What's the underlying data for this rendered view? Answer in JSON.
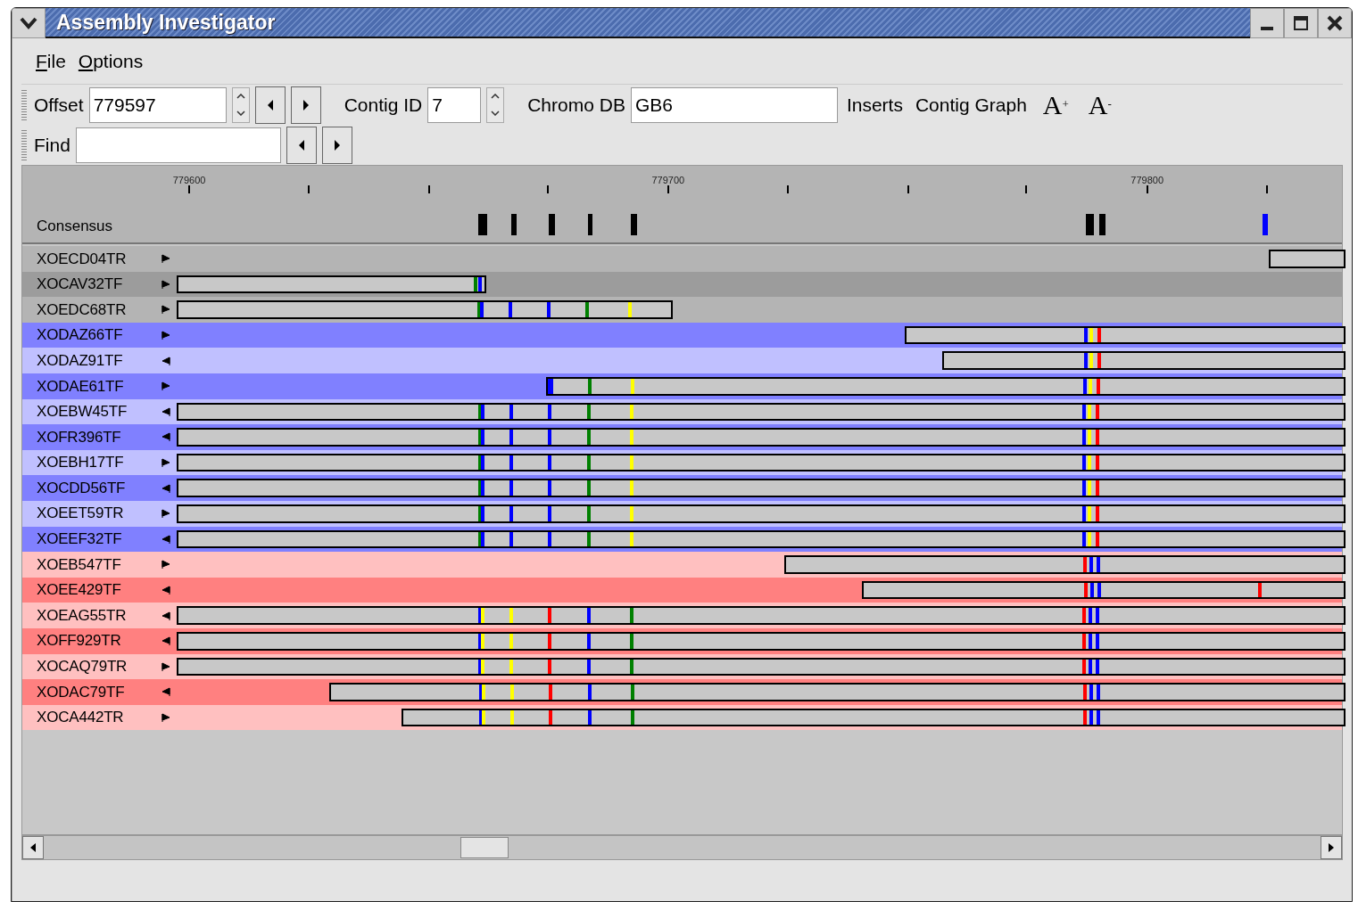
{
  "window": {
    "title": "Assembly Investigator"
  },
  "menu": [
    "File",
    "Options"
  ],
  "toolbar": {
    "offset": {
      "label": "Offset",
      "value": "779597"
    },
    "contig_id": {
      "label": "Contig ID",
      "value": "7"
    },
    "chromo_db": {
      "label": "Chromo DB",
      "value": "GB6"
    },
    "buttons": [
      "Inserts",
      "Contig Graph"
    ],
    "font_buttons": [
      "A$^{+}$",
      "A$^{-}$"
    ]
  },
  "find": {
    "label": "Find"
  },
  "ruler": {
    "labels": [
      "779600",
      "779700",
      "779800"
    ]
  },
  "consensus": {
    "label": "Consensus"
  },
  "reads": [
    {
      "name": "XOECD04TR",
      "kind": "forward",
      "color": "#b4b4b4"
    },
    {
      "name": "XOCAV32TF",
      "kind": "forward",
      "color": "#9c9c9c"
    },
    {
      "name": "XOEDC68TR",
      "kind": "forward",
      "color": "#b4b4b4"
    },
    {
      "name": "XODAZ66TF",
      "kind": "forward",
      "color": "#8080ff"
    },
    {
      "name": "XODAZ91TF",
      "kind": "reverse",
      "color": "#c0c0ff"
    },
    {
      "name": "XODAE61TF",
      "kind": "forward",
      "color": "#8080ff"
    },
    {
      "name": "XOEBW45TF",
      "kind": "reverse",
      "color": "#c0c0ff"
    },
    {
      "name": "XOFR396TF",
      "kind": "reverse",
      "color": "#8080ff"
    },
    {
      "name": "XOEBH17TF",
      "kind": "forward",
      "color": "#c0c0ff"
    },
    {
      "name": "XOCDD56TF",
      "kind": "reverse",
      "color": "#8080ff"
    },
    {
      "name": "XOEET59TR",
      "kind": "forward",
      "color": "#c0c0ff"
    },
    {
      "name": "XOEEF32TF",
      "kind": "reverse",
      "color": "#8080ff"
    },
    {
      "name": "XOEB547TF",
      "kind": "forward",
      "color": "#ffc0c0"
    },
    {
      "name": "XOEE429TF",
      "kind": "reverse",
      "color": "#ff8080"
    },
    {
      "name": "XOEAG55TR",
      "kind": "reverse",
      "color": "#ffc0c0"
    },
    {
      "name": "XOFF929TR",
      "kind": "reverse",
      "color": "#ff8080"
    },
    {
      "name": "XOCAQ79TR",
      "kind": "forward",
      "color": "#ffc0c0"
    },
    {
      "name": "XODAC79TF",
      "kind": "reverse",
      "color": "#ff8080"
    },
    {
      "name": "XOCA442TR",
      "kind": "forward",
      "color": "#ffc0c0"
    }
  ]
}
